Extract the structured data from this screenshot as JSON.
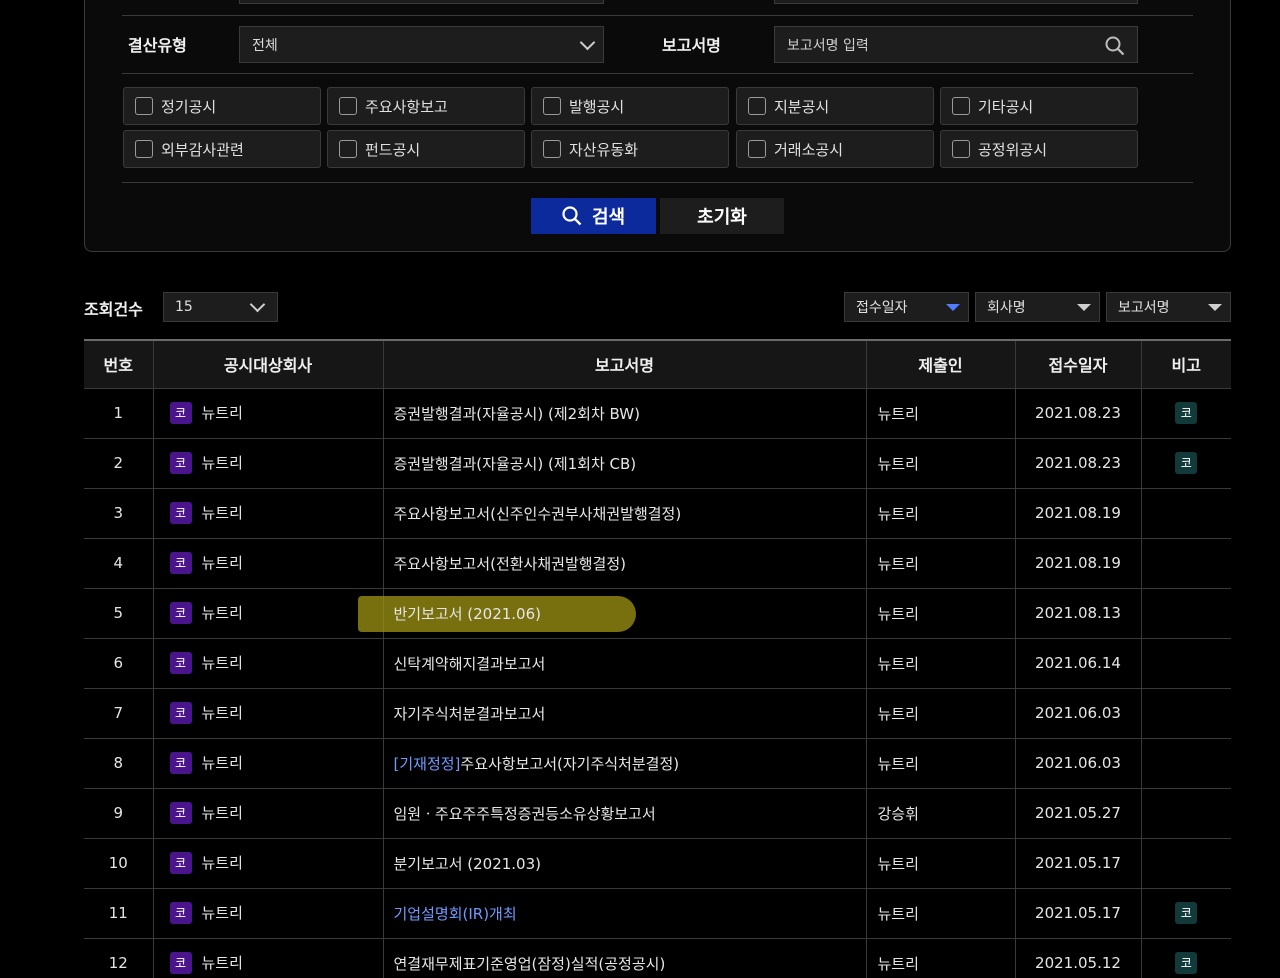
{
  "filters": {
    "settlement_label": "결산유형",
    "settlement_value": "전체",
    "report_name_label": "보고서명",
    "report_name_placeholder": "보고서명 입력",
    "disclosure_types": [
      "정기공시",
      "주요사항보고",
      "발행공시",
      "지분공시",
      "기타공시",
      "외부감사관련",
      "펀드공시",
      "자산유동화",
      "거래소공시",
      "공정위공시"
    ],
    "search_label": "검색",
    "reset_label": "초기화"
  },
  "results": {
    "count_label": "조회건수",
    "count_value": "15",
    "sort_options": [
      "접수일자",
      "회사명",
      "보고서명"
    ]
  },
  "table": {
    "headers": [
      "번호",
      "공시대상회사",
      "보고서명",
      "제출인",
      "접수일자",
      "비고"
    ],
    "rows": [
      {
        "no": "1",
        "badge": "코",
        "company": "뉴트리",
        "tag": "",
        "report": "증권발행결과(자율공시) (제2회차 BW)",
        "submitter": "뉴트리",
        "date": "2021.08.23",
        "note": "코"
      },
      {
        "no": "2",
        "badge": "코",
        "company": "뉴트리",
        "tag": "",
        "report": "증권발행결과(자율공시) (제1회차 CB)",
        "submitter": "뉴트리",
        "date": "2021.08.23",
        "note": "코"
      },
      {
        "no": "3",
        "badge": "코",
        "company": "뉴트리",
        "tag": "",
        "report": "주요사항보고서(신주인수권부사채권발행결정)",
        "submitter": "뉴트리",
        "date": "2021.08.19",
        "note": ""
      },
      {
        "no": "4",
        "badge": "코",
        "company": "뉴트리",
        "tag": "",
        "report": "주요사항보고서(전환사채권발행결정)",
        "submitter": "뉴트리",
        "date": "2021.08.19",
        "note": ""
      },
      {
        "no": "5",
        "badge": "코",
        "company": "뉴트리",
        "tag": "",
        "report": "반기보고서 (2021.06)",
        "submitter": "뉴트리",
        "date": "2021.08.13",
        "note": ""
      },
      {
        "no": "6",
        "badge": "코",
        "company": "뉴트리",
        "tag": "",
        "report": "신탁계약해지결과보고서",
        "submitter": "뉴트리",
        "date": "2021.06.14",
        "note": ""
      },
      {
        "no": "7",
        "badge": "코",
        "company": "뉴트리",
        "tag": "",
        "report": "자기주식처분결과보고서",
        "submitter": "뉴트리",
        "date": "2021.06.03",
        "note": ""
      },
      {
        "no": "8",
        "badge": "코",
        "company": "뉴트리",
        "tag": "[기재정정]",
        "report": "주요사항보고서(자기주식처분결정)",
        "submitter": "뉴트리",
        "date": "2021.06.03",
        "note": ""
      },
      {
        "no": "9",
        "badge": "코",
        "company": "뉴트리",
        "tag": "",
        "report": "임원ㆍ주요주주특정증권등소유상황보고서",
        "submitter": "강승휘",
        "date": "2021.05.27",
        "note": ""
      },
      {
        "no": "10",
        "badge": "코",
        "company": "뉴트리",
        "tag": "",
        "report": "분기보고서 (2021.03)",
        "submitter": "뉴트리",
        "date": "2021.05.17",
        "note": ""
      },
      {
        "no": "11",
        "badge": "코",
        "company": "뉴트리",
        "tag": "",
        "report": "기업설명회(IR)개최",
        "submitter": "뉴트리",
        "date": "2021.05.17",
        "note": "코"
      },
      {
        "no": "12",
        "badge": "코",
        "company": "뉴트리",
        "tag": "",
        "report": "연결재무제표기준영업(잠정)실적(공정공시)",
        "submitter": "뉴트리",
        "date": "2021.05.12",
        "note": "코"
      }
    ]
  }
}
